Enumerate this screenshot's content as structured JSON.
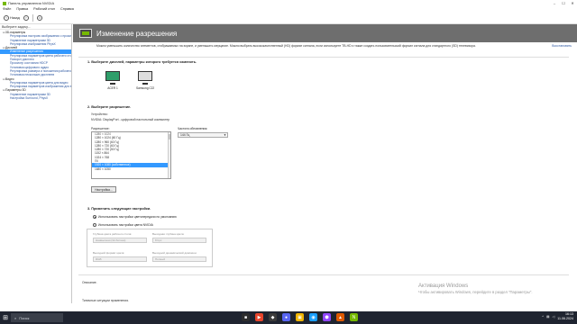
{
  "window": {
    "title": "Панель управления NVIDIA",
    "controls": [
      "–",
      "☐",
      "✕"
    ]
  },
  "menu": [
    "Файл",
    "Правка",
    "Рабочий стол",
    "Справка"
  ],
  "toolbar": {
    "back": "Назад",
    "forward": "",
    "home": ""
  },
  "left_pane": {
    "header": "Выберите задачу...",
    "tree": [
      {
        "kind": "cat",
        "label": "3D-параметры",
        "toggle": "⊟"
      },
      {
        "kind": "leaf",
        "label": "Регулировка настроек изображения с просмотром"
      },
      {
        "kind": "leaf",
        "label": "Управление параметрами 3D"
      },
      {
        "kind": "leaf",
        "label": "Регулировка изображения PhysX"
      },
      {
        "kind": "cat",
        "label": "Дисплей",
        "toggle": "⊟"
      },
      {
        "kind": "leaf",
        "label": "Изменение разрешения",
        "selected": true
      },
      {
        "kind": "leaf",
        "label": "Регулировка параметров цвета рабочего стола"
      },
      {
        "kind": "leaf",
        "label": "Поворот дисплея"
      },
      {
        "kind": "leaf",
        "label": "Просмотр состояния HDCP"
      },
      {
        "kind": "leaf",
        "label": "Установка цифрового аудио"
      },
      {
        "kind": "leaf",
        "label": "Регулировка размера и положения рабочего стола"
      },
      {
        "kind": "leaf",
        "label": "Установка нескольких дисплеев"
      },
      {
        "kind": "cat",
        "label": "Видео",
        "toggle": "⊟"
      },
      {
        "kind": "leaf",
        "label": "Регулировка параметров цвета для видео"
      },
      {
        "kind": "leaf",
        "label": "Регулировка параметров изображения для видео"
      },
      {
        "kind": "cat",
        "label": "Параметры 3D",
        "toggle": "⊟"
      },
      {
        "kind": "leaf",
        "label": "Управление параметрами 3D"
      },
      {
        "kind": "leaf",
        "label": "Настройка Surround, PhysX"
      }
    ]
  },
  "main": {
    "banner_title": "Изменение разрешения",
    "restore_link": "Восстановить",
    "intro": "Можно уменьшить количество элементов, отображаемых на экране, и уменьшить мерцание. Можно выбрать высококачественный (HD) формат сигнала, если используете ТВ-HD и также создать пользовательский формат сигнала для стандартного (SD) телевизора.",
    "section1_title": "1. Выберите дисплей, параметры которого требуется изменить.",
    "displays": [
      {
        "label": "ACER 1",
        "active": true
      },
      {
        "label": "Samsung C22",
        "active": false
      }
    ],
    "section2_title": "2. Выберите разрешение.",
    "connector_label": "Устройство:",
    "connector_value": "NVIDIA: DisplayPort - цифровой настольный компьютер",
    "resolution_label": "Разрешение:",
    "resolutions": [
      {
        "text": "1280 × 1024",
        "kind": "grp"
      },
      {
        "text": "1280 × 1024 (60 Гц)",
        "kind": "item"
      },
      {
        "text": "1280 × 960 (60 Гц)",
        "kind": "item"
      },
      {
        "text": "1280 × 720 (60 Гц)",
        "kind": "item"
      },
      {
        "text": "1280 × 720 (50 Гц)",
        "kind": "item"
      },
      {
        "text": "1152 × 864",
        "kind": "item"
      },
      {
        "text": "1024 × 768",
        "kind": "item"
      },
      {
        "text": "ПК",
        "kind": "grp"
      },
      {
        "text": "1920 × 1080 (собственное)",
        "kind": "sel"
      },
      {
        "text": "1680 × 1050",
        "kind": "item"
      }
    ],
    "refresh_label": "Частота обновления:",
    "refresh_value": "144 Гц",
    "customize_button": "Настройка...",
    "section3_title": "3. Применить следующие настройки.",
    "radio_default": "Использовать настройки цветопередачи по умолчанию",
    "radio_nvidia": "Использовать настройки цвета NVIDIA",
    "fields": {
      "desktop_depth_label": "Глубина цвета рабочего стола:",
      "desktop_depth_value": "Наивысшая (32-битная)",
      "output_depth_label": "Выходная глубина цвета:",
      "output_depth_value": "8 bpc",
      "output_format_label": "Выходной формат цвета:",
      "output_format_value": "RGB",
      "dynamic_range_label": "Выходной динамический диапазон:",
      "dynamic_range_value": "Полный"
    },
    "description_label": "Описание.",
    "usage_label": "Типичные ситуации применения."
  },
  "watermark": {
    "line1": "Активация Windows",
    "line2": "Чтобы активировать Windows, перейдите в раздел \"Параметры\"."
  },
  "taskbar": {
    "search_text": "Поиск",
    "apps": [
      {
        "glyph": "■",
        "color": "#2d2d2d"
      },
      {
        "glyph": "▶",
        "color": "#e8452c"
      },
      {
        "glyph": "◆",
        "color": "#3b3b3b"
      },
      {
        "glyph": "●",
        "color": "#5865f2"
      },
      {
        "glyph": "▣",
        "color": "#f0b400"
      },
      {
        "glyph": "◉",
        "color": "#1a9fff"
      },
      {
        "glyph": "⬢",
        "color": "#9146ff"
      },
      {
        "glyph": "▲",
        "color": "#e05a00"
      },
      {
        "glyph": "N",
        "color": "#76b900"
      }
    ],
    "time": "16:13",
    "date": "11.06.2024"
  }
}
